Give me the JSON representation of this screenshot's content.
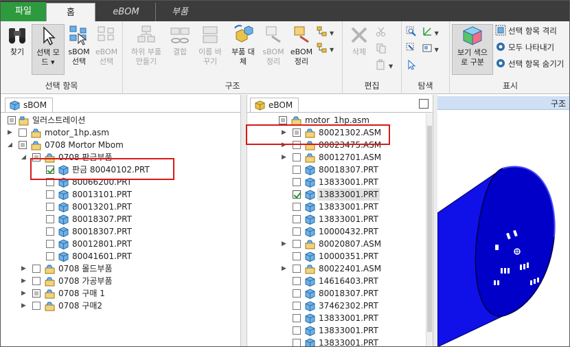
{
  "tabs": {
    "file": "파일",
    "home": "홈",
    "ebom": "eBOM",
    "part": "부품"
  },
  "ribbon": {
    "groups": {
      "select": "선택 항목",
      "structure": "구조",
      "edit": "편집",
      "search": "탐색",
      "display": "표시"
    },
    "find": "찾기",
    "select_mode": [
      "선택 모",
      "드 ▾"
    ],
    "sbom_select": [
      "sBOM",
      "선택"
    ],
    "ebom_select": [
      "eBOM",
      "선택"
    ],
    "make_sub_part": [
      "하위 부품",
      "만들기"
    ],
    "combine": [
      "결합",
      ""
    ],
    "rename": [
      "이름 바",
      "꾸기"
    ],
    "replace_part": [
      "부품 대",
      "체"
    ],
    "sbom_arrange": [
      "sBOM",
      "정리"
    ],
    "ebom_arrange": [
      "eBOM",
      "정리"
    ],
    "delete": "삭제",
    "view_color": [
      "보기 색으",
      "로 구분"
    ],
    "isolate_selected": "선택 항목 격리",
    "show_all": "모두 나타내기",
    "hide_selected": "선택 항목 숨기기"
  },
  "sbom": {
    "tab_label": "sBOM",
    "rows": [
      {
        "label": "일러스트레이션",
        "level": 0,
        "arrow": "",
        "checkbox": "none",
        "icon": "asm-box"
      },
      {
        "label": "motor_1hp.asm",
        "level": 0,
        "arrow": "▶",
        "checkbox": "unchecked",
        "icon": "asm"
      },
      {
        "label": "0708 Mortor Mbom",
        "level": 0,
        "arrow": "◢",
        "checkbox": "box",
        "icon": "asm"
      },
      {
        "label": "0708 판금부품",
        "level": 1,
        "arrow": "◢",
        "checkbox": "box",
        "icon": "asm"
      },
      {
        "label": "판금 80040102.PRT",
        "level": 2,
        "arrow": "",
        "checkbox": "checked",
        "icon": "prt"
      },
      {
        "label": "80066200.PRT",
        "level": 2,
        "arrow": "",
        "checkbox": "unchecked",
        "icon": "prt"
      },
      {
        "label": "80013101.PRT",
        "level": 2,
        "arrow": "",
        "checkbox": "unchecked",
        "icon": "prt"
      },
      {
        "label": "80013201.PRT",
        "level": 2,
        "arrow": "",
        "checkbox": "unchecked",
        "icon": "prt"
      },
      {
        "label": "80018307.PRT",
        "level": 2,
        "arrow": "",
        "checkbox": "unchecked",
        "icon": "prt"
      },
      {
        "label": "80018307.PRT",
        "level": 2,
        "arrow": "",
        "checkbox": "unchecked",
        "icon": "prt"
      },
      {
        "label": "80012801.PRT",
        "level": 2,
        "arrow": "",
        "checkbox": "unchecked",
        "icon": "prt"
      },
      {
        "label": "80041601.PRT",
        "level": 2,
        "arrow": "",
        "checkbox": "unchecked",
        "icon": "prt"
      },
      {
        "label": "0708 몰드부품",
        "level": 1,
        "arrow": "▶",
        "checkbox": "unchecked",
        "icon": "asm"
      },
      {
        "label": "0708 가공부품",
        "level": 1,
        "arrow": "▶",
        "checkbox": "unchecked",
        "icon": "asm"
      },
      {
        "label": "0708 구매 1",
        "level": 1,
        "arrow": "▶",
        "checkbox": "box",
        "icon": "asm"
      },
      {
        "label": "0708 구매2",
        "level": 1,
        "arrow": "▶",
        "checkbox": "unchecked",
        "icon": "asm"
      }
    ]
  },
  "ebom": {
    "tab_label": "eBOM",
    "rows": [
      {
        "label": "motor_1hp.asm",
        "level": 0,
        "arrow": "",
        "checkbox": "box",
        "icon": "asm",
        "selected": false
      },
      {
        "label": "80021302.ASM",
        "level": 1,
        "arrow": "▶",
        "checkbox": "box",
        "icon": "asm",
        "selected": false
      },
      {
        "label": "80023475.ASM",
        "level": 1,
        "arrow": "▶",
        "checkbox": "unchecked",
        "icon": "asm",
        "selected": false
      },
      {
        "label": "80012701.ASM",
        "level": 1,
        "arrow": "▶",
        "checkbox": "unchecked",
        "icon": "asm",
        "selected": false
      },
      {
        "label": "80018307.PRT",
        "level": 1,
        "arrow": "",
        "checkbox": "unchecked",
        "icon": "prt",
        "selected": false
      },
      {
        "label": "13833001.PRT",
        "level": 1,
        "arrow": "",
        "checkbox": "unchecked",
        "icon": "prt",
        "selected": false
      },
      {
        "label": "13833001.PRT",
        "level": 1,
        "arrow": "",
        "checkbox": "checked",
        "icon": "prt",
        "selected": true
      },
      {
        "label": "13833001.PRT",
        "level": 1,
        "arrow": "",
        "checkbox": "unchecked",
        "icon": "prt",
        "selected": false
      },
      {
        "label": "13833001.PRT",
        "level": 1,
        "arrow": "",
        "checkbox": "unchecked",
        "icon": "prt",
        "selected": false
      },
      {
        "label": "10000432.PRT",
        "level": 1,
        "arrow": "",
        "checkbox": "unchecked",
        "icon": "prt",
        "selected": false
      },
      {
        "label": "80020807.ASM",
        "level": 1,
        "arrow": "▶",
        "checkbox": "unchecked",
        "icon": "asm",
        "selected": false
      },
      {
        "label": "10000351.PRT",
        "level": 1,
        "arrow": "",
        "checkbox": "unchecked",
        "icon": "prt",
        "selected": false
      },
      {
        "label": "80022401.ASM",
        "level": 1,
        "arrow": "▶",
        "checkbox": "unchecked",
        "icon": "asm",
        "selected": false
      },
      {
        "label": "14616403.PRT",
        "level": 1,
        "arrow": "",
        "checkbox": "unchecked",
        "icon": "prt",
        "selected": false
      },
      {
        "label": "80018307.PRT",
        "level": 1,
        "arrow": "",
        "checkbox": "unchecked",
        "icon": "prt",
        "selected": false
      },
      {
        "label": "37462302.PRT",
        "level": 1,
        "arrow": "",
        "checkbox": "unchecked",
        "icon": "prt",
        "selected": false
      },
      {
        "label": "13833001.PRT",
        "level": 1,
        "arrow": "",
        "checkbox": "unchecked",
        "icon": "prt",
        "selected": false
      },
      {
        "label": "13833001.PRT",
        "level": 1,
        "arrow": "",
        "checkbox": "unchecked",
        "icon": "prt",
        "selected": false
      },
      {
        "label": "13833001.PRT",
        "level": 1,
        "arrow": "",
        "checkbox": "unchecked",
        "icon": "prt",
        "selected": false
      }
    ]
  },
  "view": {
    "title": "구조"
  },
  "colors": {
    "file_tab": "#2e9a3e",
    "highlight": "#d81818",
    "part_blue": "#1010e8",
    "asm_yellow": "#e8c24a",
    "prt_blue": "#6fb1e6"
  }
}
